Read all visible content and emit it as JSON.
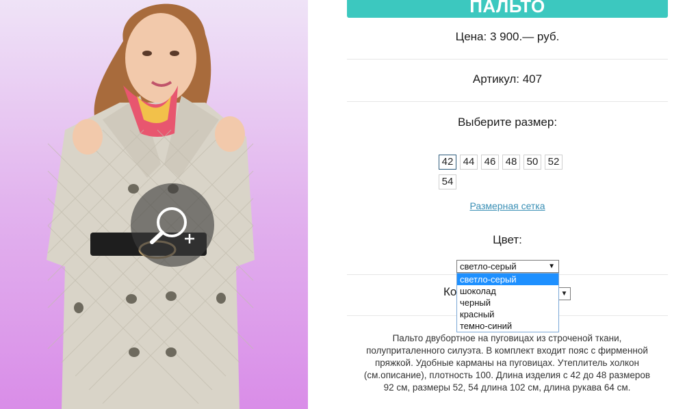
{
  "product": {
    "title": "ПАЛЬТО",
    "price": "Цена: 3 900.— руб.",
    "article": "Артикул: 407",
    "choose_size_label": "Выберите размер:",
    "sizes": [
      "42",
      "44",
      "46",
      "48",
      "50",
      "52",
      "54"
    ],
    "selected_size": "42",
    "size_chart_link": "Размерная сетка",
    "color_label": "Цвет:",
    "color_select": {
      "value": "светло-серый",
      "options": [
        "светло-серый",
        "шоколад",
        "черный",
        "красный",
        "темно-синий"
      ]
    },
    "quantity_label_partial": "Ко",
    "description": "Пальто двубортное на пуговицах из строченой ткани, полуприталенного силуэта. В комплект входит пояс с фирменной пряжкой. Удобные карманы на пуговицах. Утеплитель холкон (см.описание), плотность 100. Длина изделия с 42 до 48 размеров 92 см, размеры 52, 54 длина 102 см, длина рукава 64 см."
  },
  "icons": {
    "zoom": "zoom-in-icon"
  },
  "colors": {
    "accent": "#3cc8bf",
    "link": "#3a8fb5",
    "dropdown_highlight": "#1e90ff",
    "photo_bg_top": "#efe3f7",
    "photo_bg_bottom": "#d98de8"
  }
}
